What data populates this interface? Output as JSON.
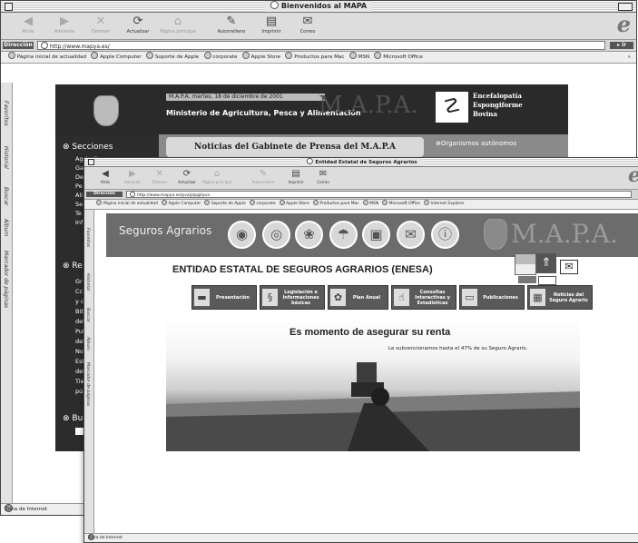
{
  "back_window": {
    "title": "Bienvenidos al MAPA",
    "toolbar": [
      {
        "label": "Atrás",
        "icon": "◀",
        "enabled": false
      },
      {
        "label": "Adelante",
        "icon": "▶",
        "enabled": false
      },
      {
        "label": "Detener",
        "icon": "✕",
        "enabled": false
      },
      {
        "label": "Actualizar",
        "icon": "⟳",
        "enabled": true
      },
      {
        "label": "Página principal",
        "icon": "⌂",
        "enabled": false
      },
      {
        "label": "Autorrelleno",
        "icon": "✎",
        "enabled": true
      },
      {
        "label": "Imprimir",
        "icon": "▤",
        "enabled": true
      },
      {
        "label": "Correo",
        "icon": "✉",
        "enabled": true
      }
    ],
    "address_label": "Dirección",
    "address_value": "http://www.mapya.es/",
    "go_label": "ir",
    "favorites": [
      "Página inicial de actualidad",
      "Apple Computer",
      "Soporte de Apple",
      "corporate",
      "Apple Store",
      "Productos para Mac",
      "MSN",
      "Microsoft Office"
    ],
    "favorites_more": "»",
    "side_tabs": [
      "Favoritos",
      "Historial",
      "Buscar",
      "Álbum",
      "Marcador de páginas"
    ],
    "status_text": "Zona de Internet",
    "page": {
      "date_line": "M.A.P.A. martes, 18 de diciembre de 2001",
      "ministry": "Ministerio de Agricultura, Pesca y Alimentación",
      "watermark": "M.A.P.A.",
      "ee_lines": [
        "Encefalopatía",
        "Espongiforme",
        "Bovina"
      ],
      "secciones": "Secciones",
      "nav_items": [
        "Agricultura",
        "Ga",
        "De",
        "Pe",
        "Ali",
        "Se",
        "Te",
        "Inf"
      ],
      "press": "Noticias del Gabinete de Prensa del M.A.P.A",
      "organismos": "Organismos autónomos",
      "re_heading": "Re",
      "re_items": [
        "Gr",
        "Cc",
        "y c",
        "Bib",
        "del",
        "Pul",
        "del",
        "Not",
        "Est",
        "del",
        "Tie",
        "pú"
      ],
      "bu_heading": "Bu"
    }
  },
  "front_window": {
    "title": "Entidad Estatal de Seguros Agrarios",
    "toolbar": [
      {
        "label": "Atrás",
        "icon": "◀",
        "enabled": true
      },
      {
        "label": "Adelante",
        "icon": "▶",
        "enabled": false
      },
      {
        "label": "Detener",
        "icon": "✕",
        "enabled": false
      },
      {
        "label": "Actualizar",
        "icon": "⟳",
        "enabled": true
      },
      {
        "label": "Página principal",
        "icon": "⌂",
        "enabled": false
      },
      {
        "label": "Autorrelleno",
        "icon": "✎",
        "enabled": false
      },
      {
        "label": "Imprimir",
        "icon": "▤",
        "enabled": true
      },
      {
        "label": "Correo",
        "icon": "✉",
        "enabled": true
      }
    ],
    "address_label": "Dirección",
    "address_value": "http://www.mapya.es/pva/plpgl/pva",
    "favorites": [
      "Página inicial de actualidad",
      "Apple Computer",
      "Soporte de Apple",
      "corporate",
      "Apple Store",
      "Productos para Mac",
      "MSN",
      "Microsoft Office",
      "Internet Explorer"
    ],
    "side_tabs": [
      "Favoritos",
      "Historial",
      "Buscar",
      "Álbum",
      "Marcador de páginas"
    ],
    "status_text": "Zona de Internet",
    "page": {
      "banner_left": "Seguros Agrarios",
      "banner_right": "M.A.P.A.",
      "title": "ENTIDAD ESTATAL DE SEGUROS AGRARIOS (ENESA)",
      "nav": [
        {
          "label": "Presentación",
          "icon": "▬"
        },
        {
          "label": "Legislación e Informaciones básicas",
          "icon": "§"
        },
        {
          "label": "Plan Anual",
          "icon": "✿"
        },
        {
          "label": "Consultas Interactivas y Estadísticas",
          "icon": "☝"
        },
        {
          "label": "Publicaciones",
          "icon": "▭"
        },
        {
          "label": "Noticias del Seguro Agrario",
          "icon": "▦"
        }
      ],
      "hero_title": "Es momento de asegurar su renta",
      "hero_sub": "Le subvencionamos hasta el 47% de su Seguro Agrario."
    }
  }
}
